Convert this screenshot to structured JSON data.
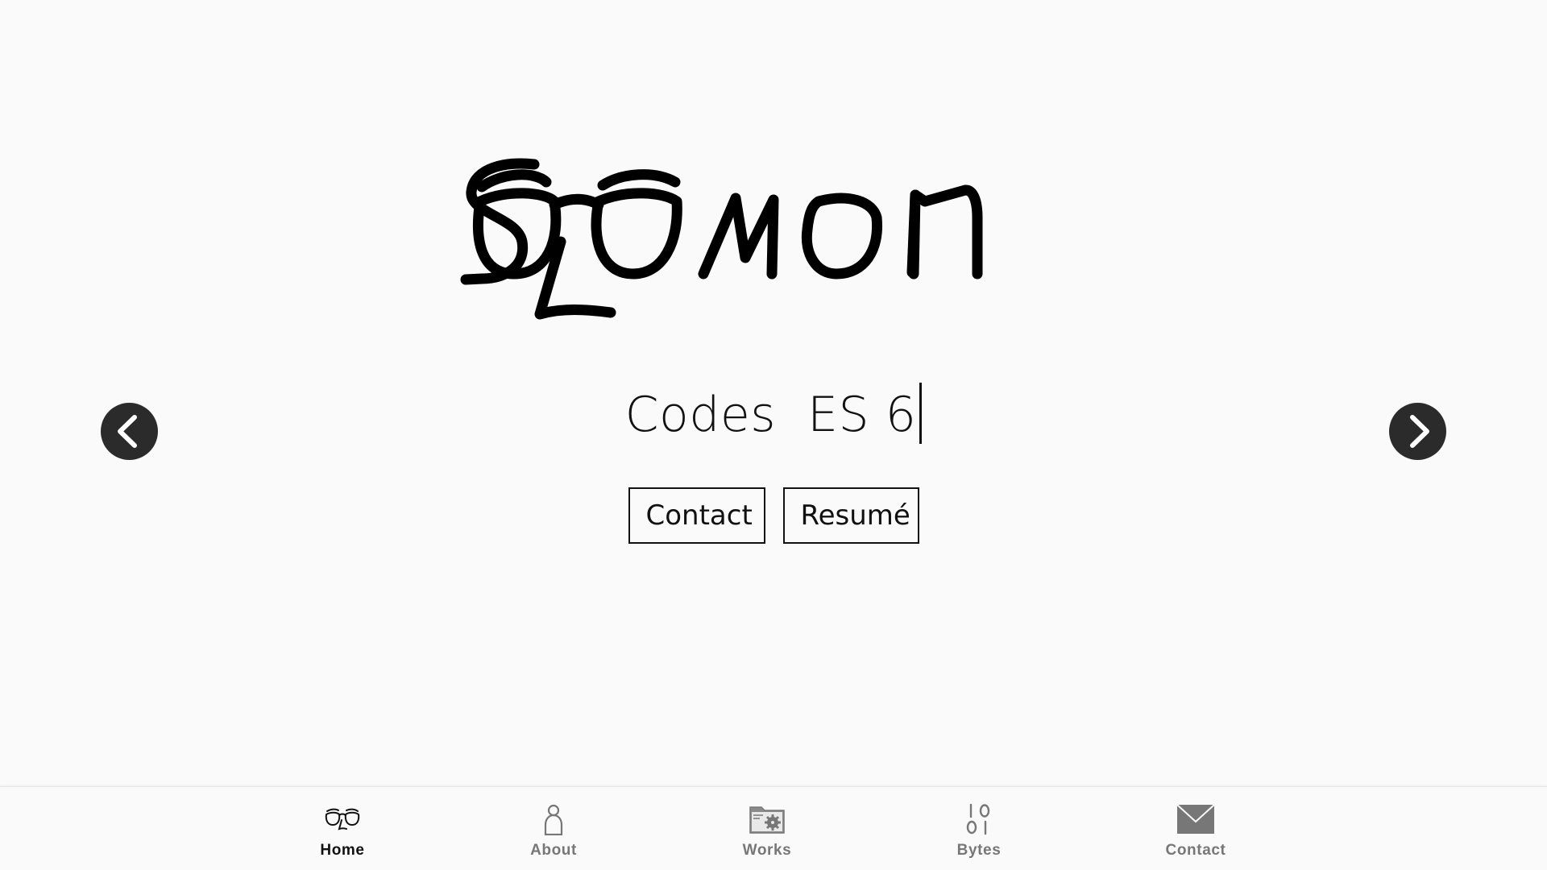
{
  "logo": {
    "alt": "Solomon"
  },
  "hero": {
    "tagline": "Codes  ES 6"
  },
  "cta": {
    "contact_label": "Contact",
    "resume_label": "Resumé"
  },
  "carousel": {
    "prev_icon": "chevron-left-icon",
    "next_icon": "chevron-right-icon"
  },
  "nav": {
    "items": [
      {
        "label": "Home",
        "icon": "glasses-icon",
        "active": true
      },
      {
        "label": "About",
        "icon": "person-icon",
        "active": false
      },
      {
        "label": "Works",
        "icon": "folder-gear-icon",
        "active": false
      },
      {
        "label": "Bytes",
        "icon": "binary-icon",
        "active": false
      },
      {
        "label": "Contact",
        "icon": "envelope-icon",
        "active": false
      }
    ]
  },
  "colors": {
    "background": "#fafafa",
    "text": "#111111",
    "arrow_bg": "#2b2b2b",
    "nav_inactive": "#777777"
  }
}
